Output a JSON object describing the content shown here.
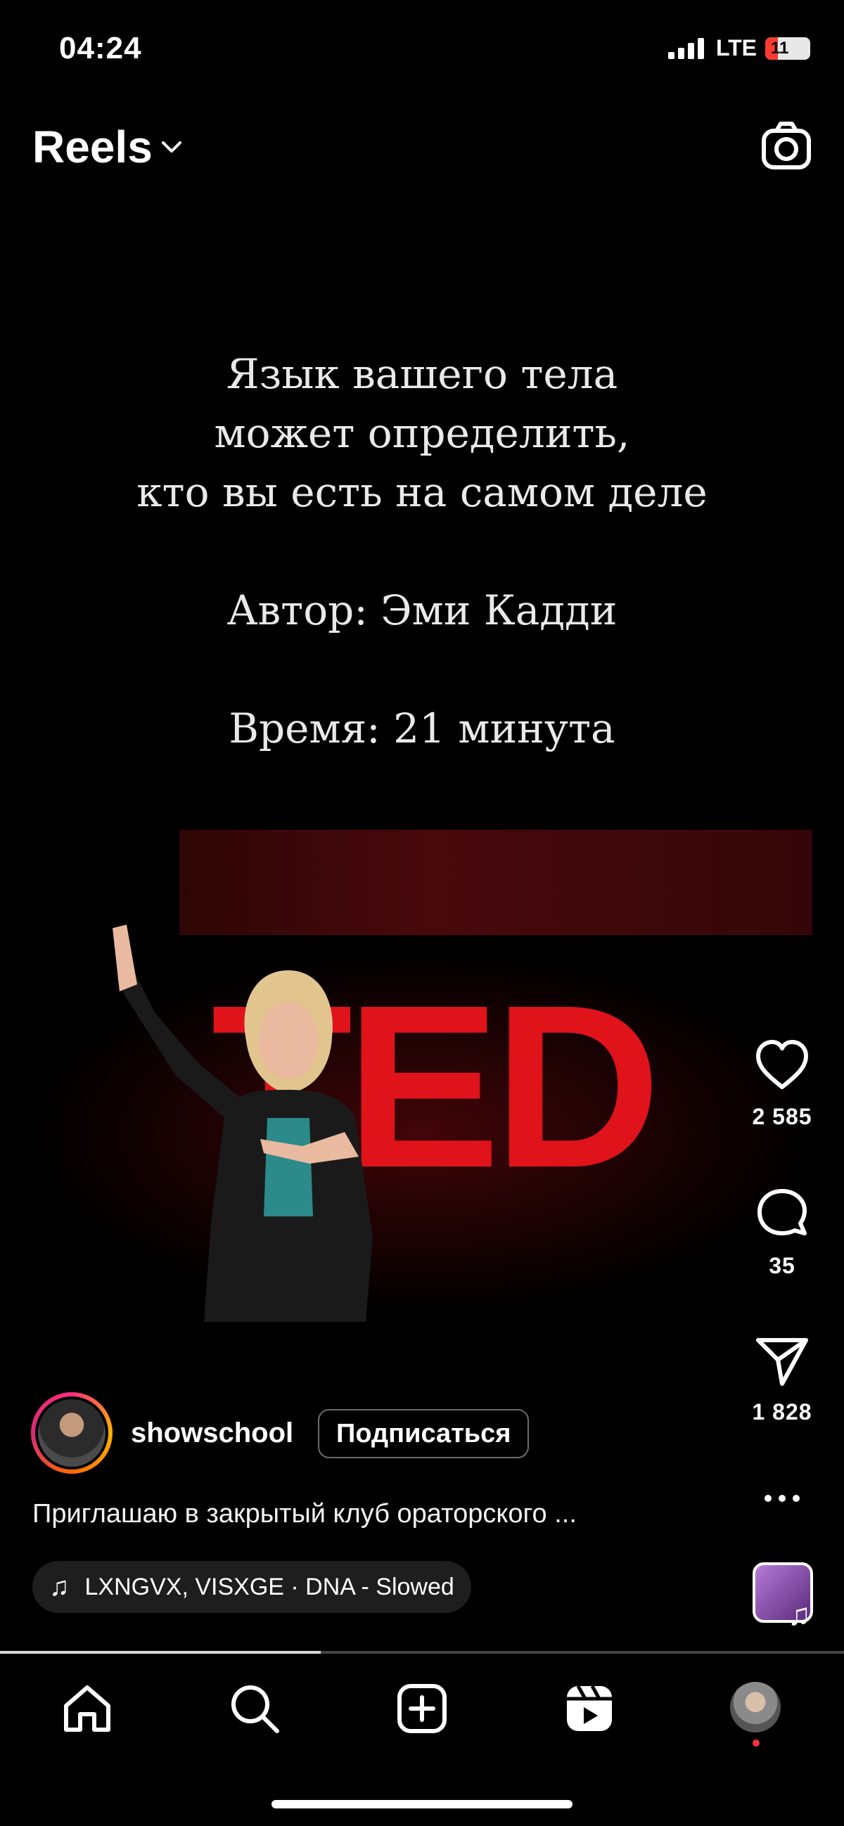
{
  "status_bar": {
    "time": "04:24",
    "network": "LTE",
    "battery": "11"
  },
  "header": {
    "title": "Reels"
  },
  "video_overlay": {
    "line1": "Язык вашего тела",
    "line2": "может определить,",
    "line3": "кто вы есть на самом деле",
    "author": "Автор: Эми Кадди",
    "duration": "Время: 21 минута",
    "logo_text": "TED"
  },
  "actions": {
    "likes": "2 585",
    "comments": "35",
    "shares": "1 828"
  },
  "post": {
    "username": "showschool",
    "follow_label": "Подписаться",
    "caption": "Приглашаю в закрытый клуб ораторского ...",
    "music": "LXNGVX, VISXGE · DNA - Slowed"
  },
  "progress": 0.38,
  "nav": [
    "home-icon",
    "search-icon",
    "create-icon",
    "reels-icon",
    "profile-avatar"
  ]
}
